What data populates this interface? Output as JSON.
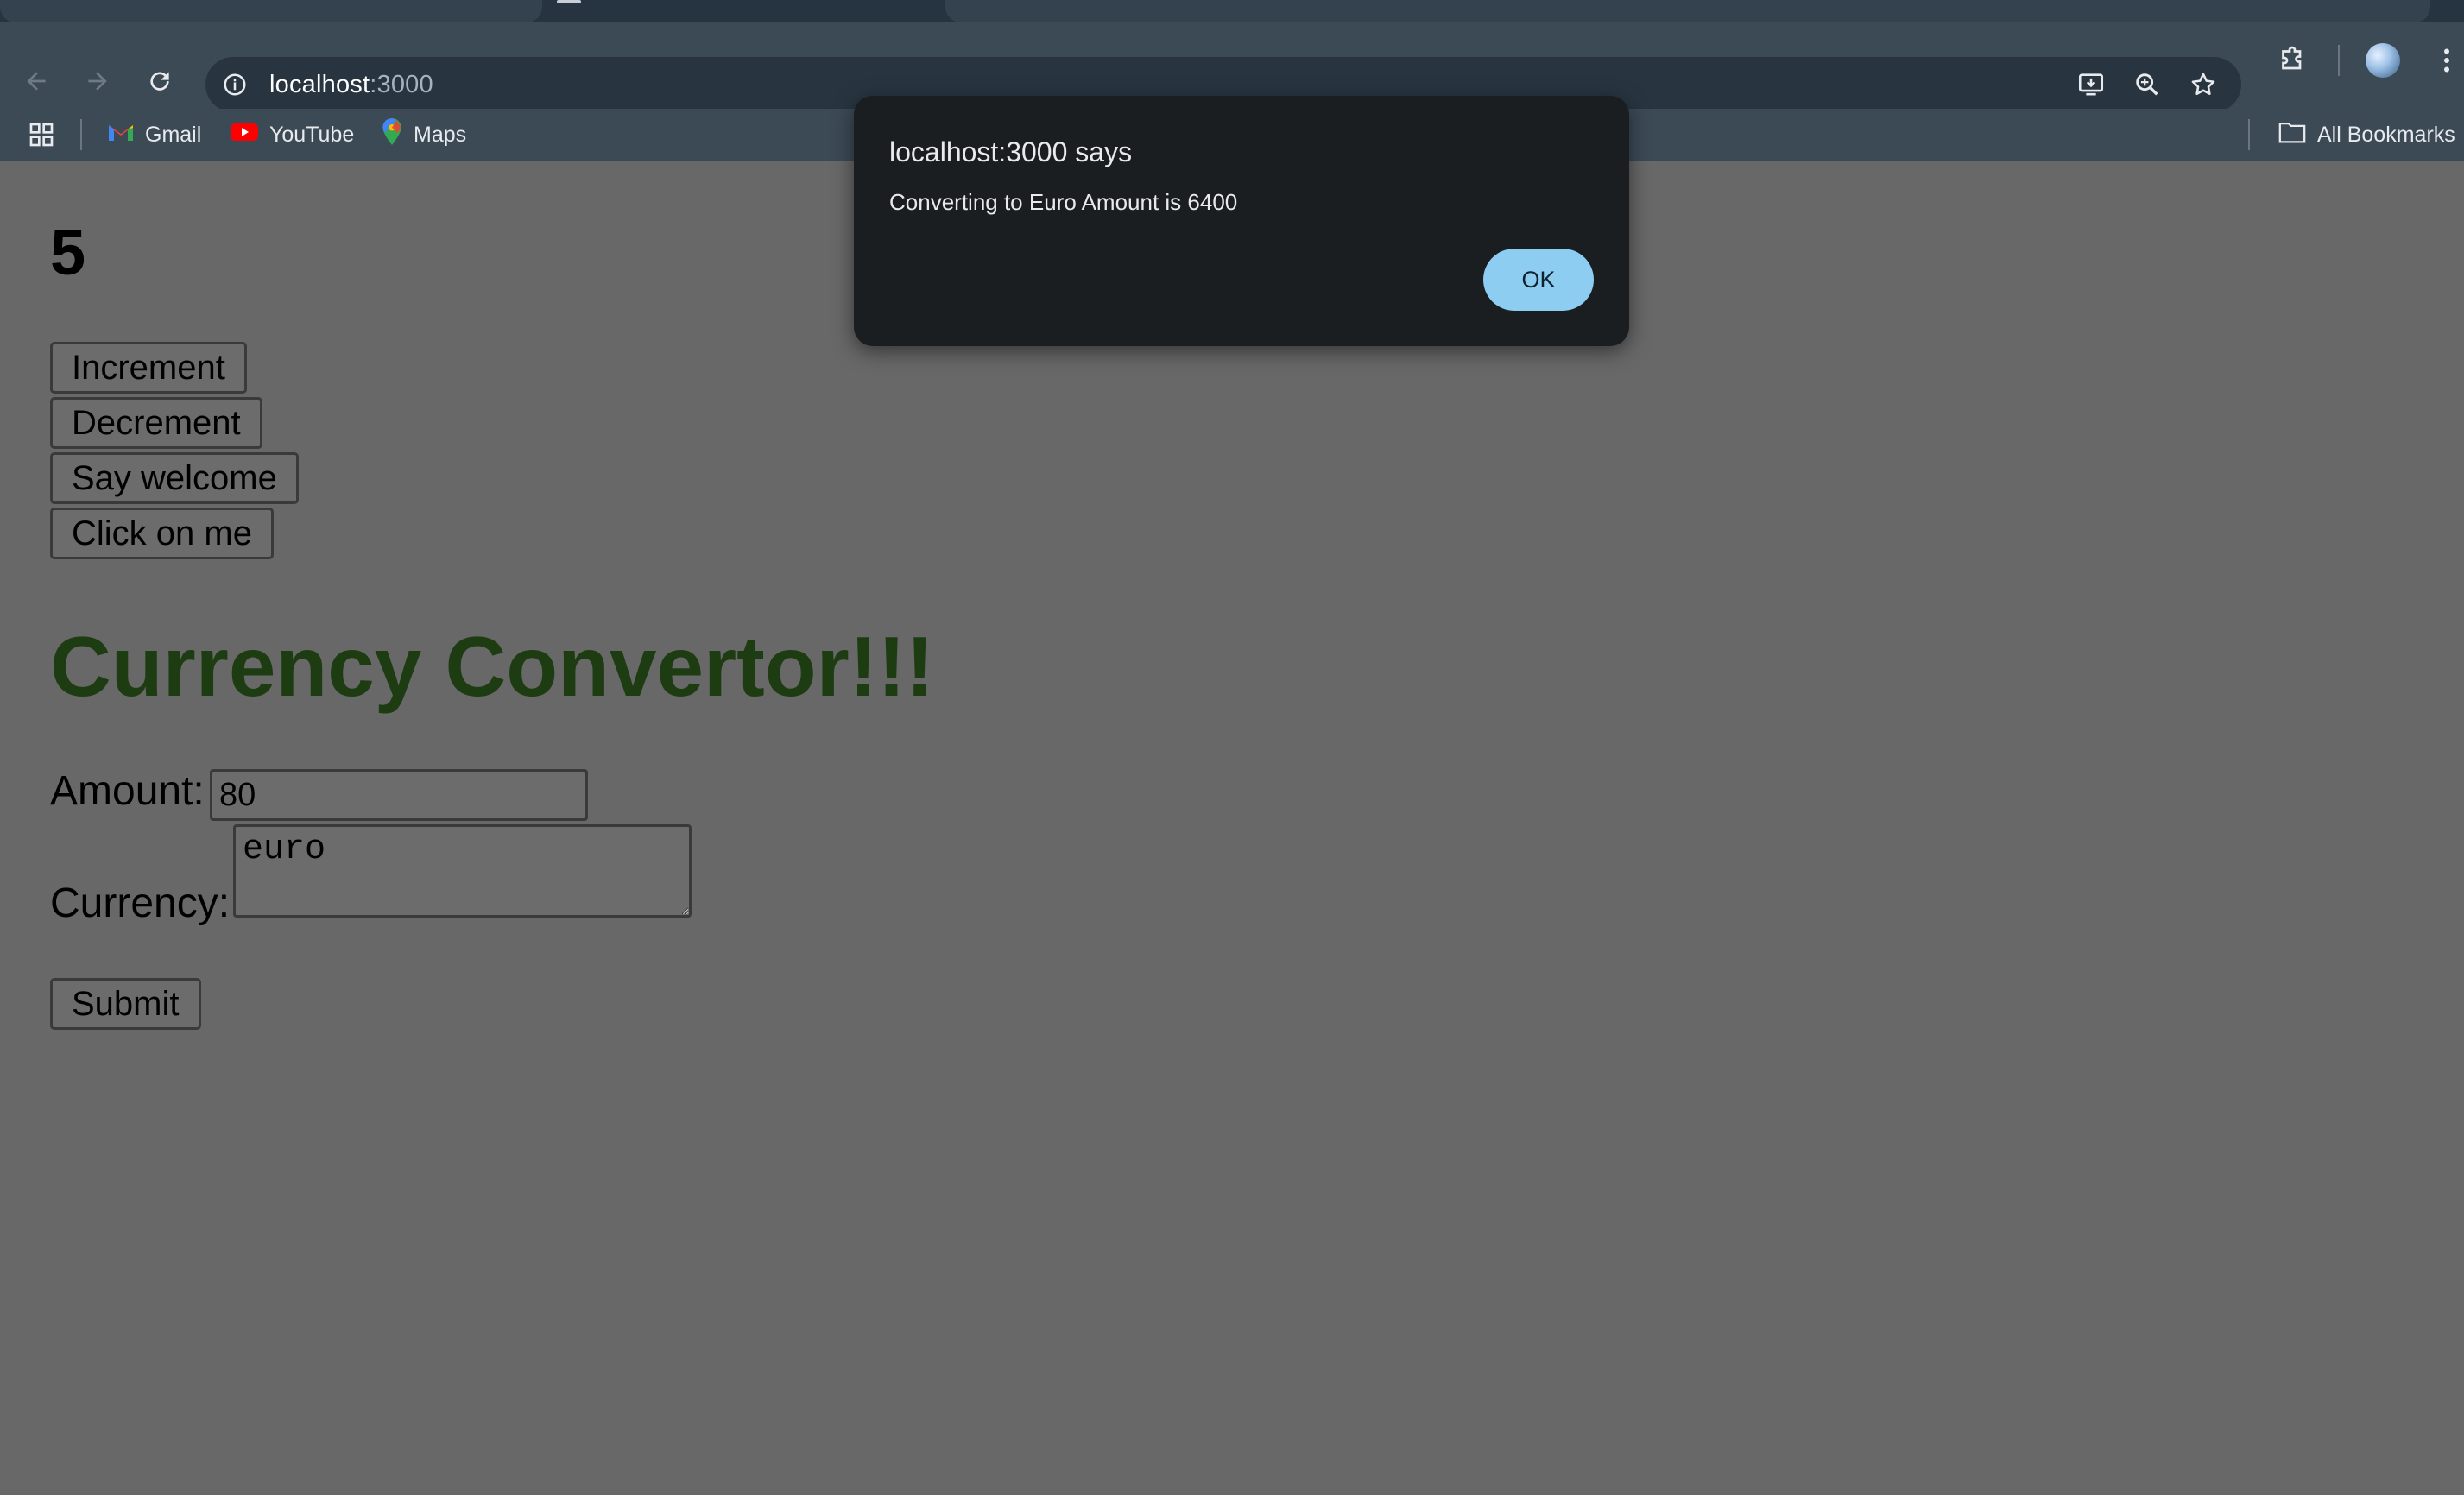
{
  "browser": {
    "url_host": "localhost",
    "url_port": ":3000",
    "bookmarks": [
      {
        "label": "Gmail",
        "icon": "gmail-icon"
      },
      {
        "label": "YouTube",
        "icon": "youtube-icon"
      },
      {
        "label": "Maps",
        "icon": "maps-icon"
      }
    ],
    "all_bookmarks_label": "All Bookmarks"
  },
  "page": {
    "counter": "5",
    "buttons": {
      "increment": "Increment",
      "decrement": "Decrement",
      "welcome": "Say welcome",
      "click": "Click on me"
    },
    "heading": "Currency Convertor!!!",
    "amount_label": "Amount:",
    "amount_value": "80",
    "currency_label": "Currency:",
    "currency_value": "euro",
    "submit_label": "Submit",
    "heading_color": "#1e3c12"
  },
  "dialog": {
    "title": "localhost:3000 says",
    "message": "Converting to Euro Amount is 6400",
    "ok_label": "OK"
  }
}
